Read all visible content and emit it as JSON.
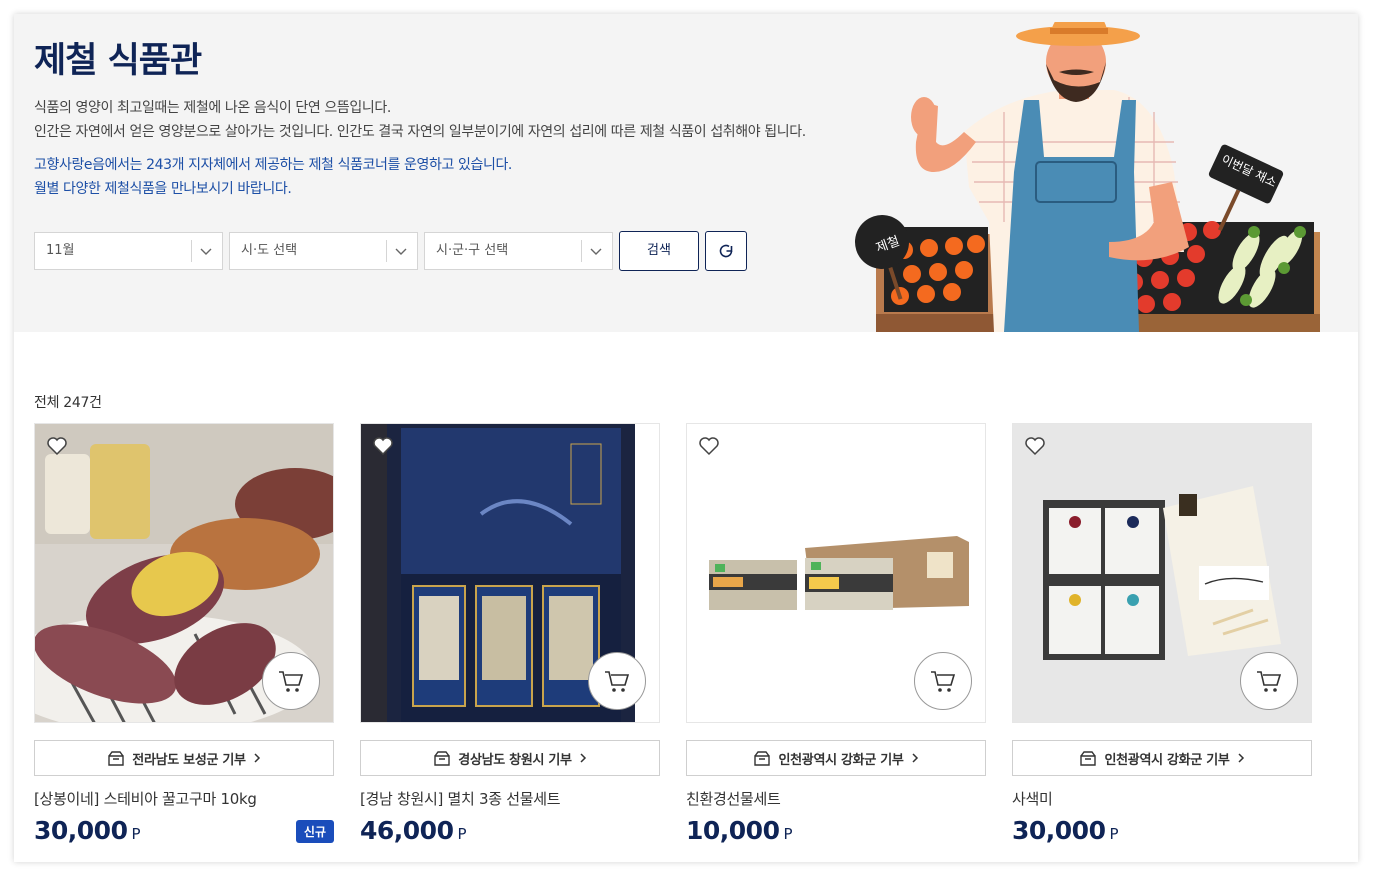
{
  "hero": {
    "title": "제철 식품관",
    "desc_line1": "식품의 영양이 최고일때는 제철에 나온 음식이 단연 으뜸입니다.",
    "desc_line2": "인간은 자연에서 얻은 영양분으로 살아가는 것입니다. 인간도 결국 자연의 일부분이기에 자연의 섭리에 따른 제철 식품이 섭취해야 됩니다.",
    "info_line1": "고향사랑e음에서는 243개 지자체에서 제공하는 제철 식품코너를 운영하고 있습니다.",
    "info_line2": "월별 다양한 제철식품을 만나보시기 바랍니다.",
    "sign_left": "제철",
    "sign_right": "이번달 채소"
  },
  "filters": {
    "month": "11월",
    "province": "시·도 선택",
    "city": "시·군·구 선택",
    "search_label": "검색"
  },
  "list": {
    "count_label": "전체 247건"
  },
  "products": [
    {
      "donate": "전라남도 보성군 기부",
      "name": "[상봉이네] 스테비아 꿀고구마 10kg",
      "price": "30,000",
      "unit": "P",
      "badge": "신규"
    },
    {
      "donate": "경상남도 창원시 기부",
      "name": "[경남 창원시] 멸치 3종 선물세트",
      "price": "46,000",
      "unit": "P"
    },
    {
      "donate": "인천광역시 강화군 기부",
      "name": "친환경선물세트",
      "price": "10,000",
      "unit": "P"
    },
    {
      "donate": "인천광역시 강화군 기부",
      "name": "사색미",
      "price": "30,000",
      "unit": "P"
    }
  ],
  "colors": {
    "navy": "#0f2456",
    "blue_text": "#1d4fa6",
    "badge": "#1a4dbb",
    "hero_bg": "#f4f4f4"
  }
}
